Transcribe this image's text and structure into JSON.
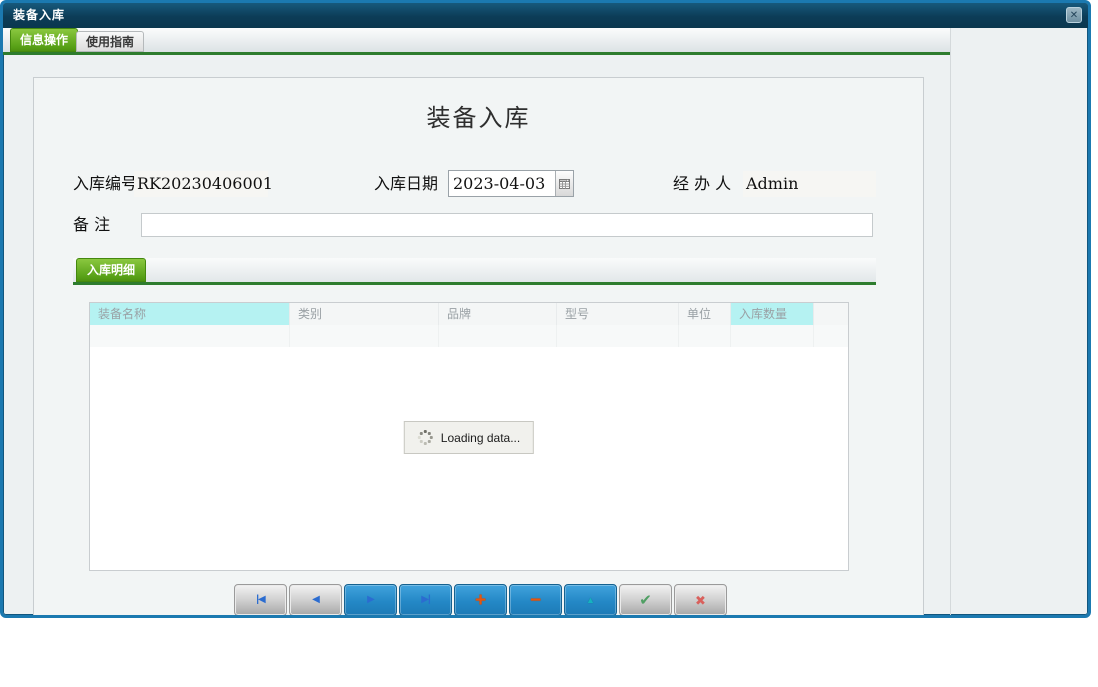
{
  "window": {
    "title": "装备入库",
    "close_glyph": "✕"
  },
  "tabs": {
    "info": {
      "label": "信息操作"
    },
    "guide": {
      "label": "使用指南"
    }
  },
  "form": {
    "title": "装备入库",
    "storage_no": {
      "label": "入库编号",
      "value": "RK20230406001"
    },
    "date": {
      "label": "入库日期",
      "value": "2023-04-03"
    },
    "handler": {
      "label": "经 办 人",
      "value": "Admin"
    },
    "remarks": {
      "label": "备 注",
      "value": "",
      "placeholder": ""
    },
    "detail_tab_label": "入库明细"
  },
  "table": {
    "columns": [
      "装备名称",
      "类别",
      "品牌",
      "型号",
      "单位",
      "入库数量"
    ],
    "highlighted_columns": [
      "装备名称",
      "入库数量"
    ],
    "loading_text": "Loading data..."
  },
  "nav": {
    "buttons": [
      {
        "name": "first",
        "glyph": "|◀"
      },
      {
        "name": "prev",
        "glyph": "◀"
      },
      {
        "name": "next",
        "glyph": "▶"
      },
      {
        "name": "last",
        "glyph": "▶|"
      },
      {
        "name": "add",
        "glyph": "+"
      },
      {
        "name": "delete",
        "glyph": "−"
      },
      {
        "name": "edit",
        "glyph": "▲"
      },
      {
        "name": "confirm",
        "glyph": "✔"
      },
      {
        "name": "cancel",
        "glyph": "✖"
      }
    ]
  },
  "colors": {
    "window_border": "#1b79b0",
    "titlebar": "#0c3c57",
    "tab_green": "#58a117",
    "green_underline": "#2e7c2e",
    "header_highlight": "#b5f2f2",
    "button_blue": "#2488c6",
    "icon_orange": "#e8550c",
    "icon_blue_arrow": "#2b6cd0"
  }
}
